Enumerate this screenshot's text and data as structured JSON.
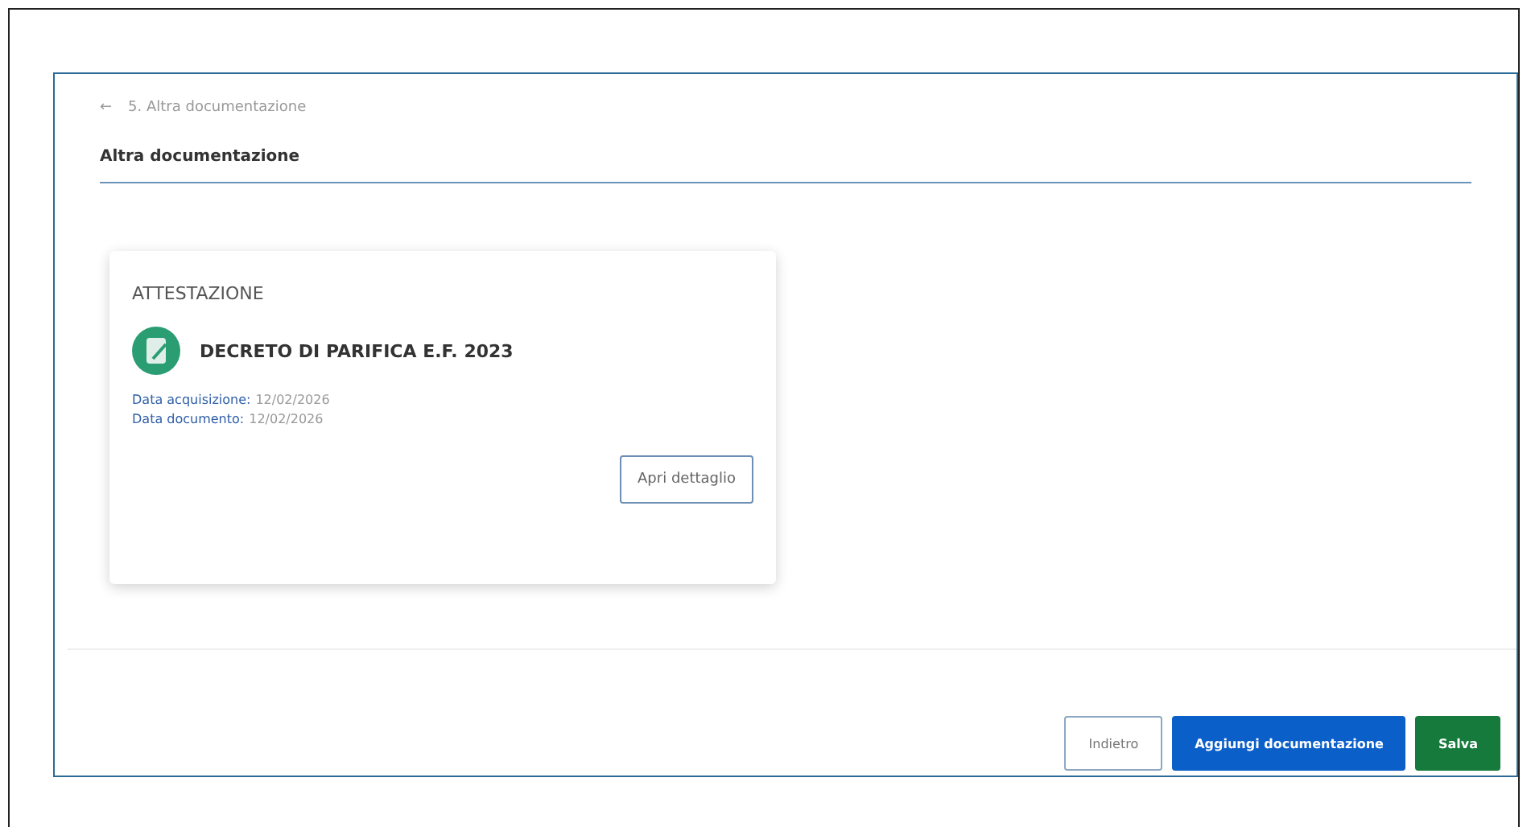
{
  "breadcrumb": {
    "back": "←",
    "label": "5. Altra documentazione"
  },
  "section_title": "Altra documentazione",
  "cards": [
    {
      "category": "ATTESTAZIONE",
      "title": "DECRETO DI PARIFICA E.F. 2023",
      "fields": [
        {
          "label": "Data acquisizione:",
          "value": "12/02/2026"
        },
        {
          "label": "Data documento:",
          "value": "12/02/2026"
        }
      ],
      "button": "Apri dettaglio"
    }
  ],
  "buttons": [
    {
      "kind": "outline",
      "label": "Indietro"
    },
    {
      "kind": "primary",
      "label": "Aggiungi documentazione"
    },
    {
      "kind": "success",
      "label": "Salva"
    }
  ]
}
